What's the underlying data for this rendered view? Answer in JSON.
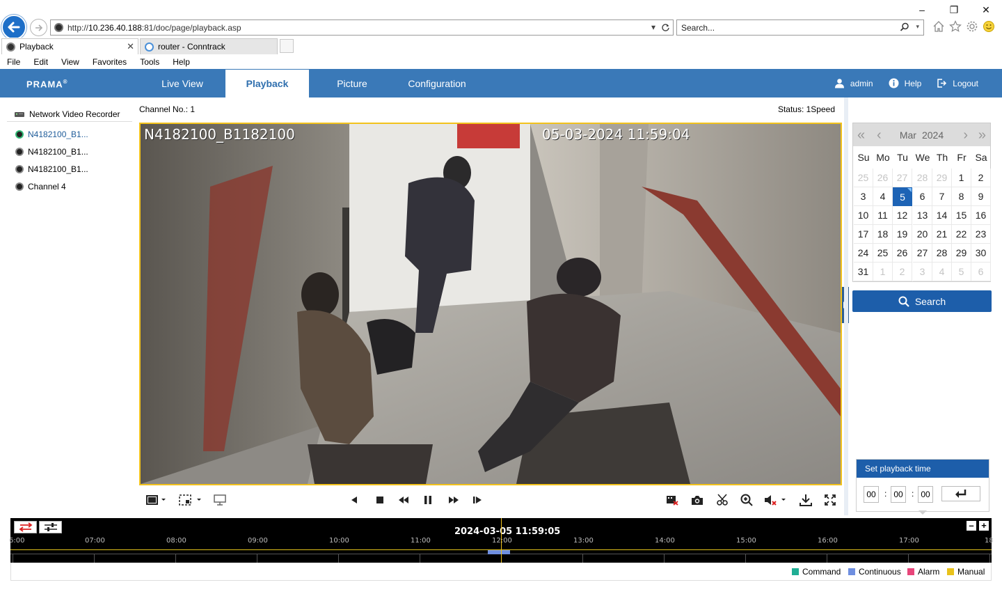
{
  "browser": {
    "url_prefix": "http://",
    "url_host": "10.236.40.188",
    "url_rest": ":81/doc/page/playback.asp",
    "search_placeholder": "Search...",
    "tabs": [
      {
        "label": "Playback",
        "active": true
      },
      {
        "label": "router - Conntrack",
        "active": false
      }
    ],
    "menu": [
      "File",
      "Edit",
      "View",
      "Favorites",
      "Tools",
      "Help"
    ]
  },
  "app": {
    "logo": "PRAMA",
    "nav_tabs": [
      "Live View",
      "Playback",
      "Picture",
      "Configuration"
    ],
    "active_tab": "Playback",
    "user": "admin",
    "help": "Help",
    "logout": "Logout",
    "accent_color": "#3a79b8"
  },
  "device_tree": {
    "root": "Network Video Recorder",
    "channels": [
      {
        "label": "N4182100_B1...",
        "selected": true
      },
      {
        "label": "N4182100_B1...",
        "selected": false
      },
      {
        "label": "N4182100_B1...",
        "selected": false
      },
      {
        "label": "Channel 4",
        "selected": false
      }
    ]
  },
  "player": {
    "channel_no": "Channel No.: 1",
    "status": "Status: 1Speed",
    "osd_name": "N4182100_B1182100",
    "osd_time": "05-03-2024 11:59:04"
  },
  "calendar": {
    "month": "Mar",
    "year": "2024",
    "weekdays": [
      "Su",
      "Mo",
      "Tu",
      "We",
      "Th",
      "Fr",
      "Sa"
    ],
    "days": [
      [
        "25",
        "26",
        "27",
        "28",
        "29",
        "1",
        "2"
      ],
      [
        "3",
        "4",
        "5",
        "6",
        "7",
        "8",
        "9"
      ],
      [
        "10",
        "11",
        "12",
        "13",
        "14",
        "15",
        "16"
      ],
      [
        "17",
        "18",
        "19",
        "20",
        "21",
        "22",
        "23"
      ],
      [
        "24",
        "25",
        "26",
        "27",
        "28",
        "29",
        "30"
      ],
      [
        "31",
        "1",
        "2",
        "3",
        "4",
        "5",
        "6"
      ]
    ],
    "selected_day": "5",
    "search_label": "Search"
  },
  "playback_time": {
    "title": "Set playback time",
    "hh": "00",
    "mm": "00",
    "ss": "00"
  },
  "timeline": {
    "current": "2024-03-05 11:59:05",
    "ticks": [
      "6:00",
      "07:00",
      "08:00",
      "09:00",
      "10:00",
      "11:00",
      "12:00",
      "13:00",
      "14:00",
      "15:00",
      "16:00",
      "17:00",
      "18"
    ]
  },
  "legend": [
    {
      "label": "Command",
      "color": "#1fae94"
    },
    {
      "label": "Continuous",
      "color": "#6f8fe0"
    },
    {
      "label": "Alarm",
      "color": "#e8457a"
    },
    {
      "label": "Manual",
      "color": "#e9c21b"
    }
  ]
}
